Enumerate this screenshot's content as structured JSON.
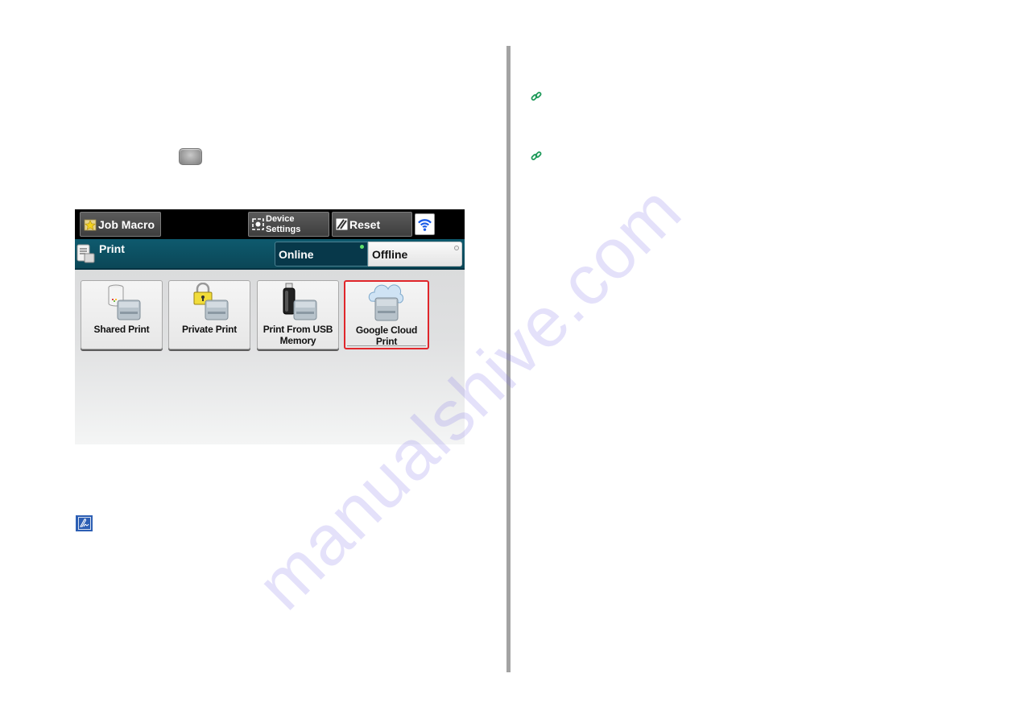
{
  "document": {
    "layout": "two-page spread",
    "left_page": {
      "hardware_key": {
        "icon": "rounded-gray-key-icon"
      },
      "panel_screenshot": {
        "top_bar": {
          "job_macro": {
            "label": "Job Macro",
            "icon": "star-folder-icon"
          },
          "device_settings": {
            "line1": "Device",
            "line2": "Settings",
            "icon": "gear-square-icon"
          },
          "reset": {
            "label": "Reset",
            "icon": "slash-reset-icon"
          },
          "wifi": {
            "icon": "wifi-icon",
            "color": "#1a5de8"
          }
        },
        "title_bar": {
          "title": "Print",
          "icon": "print-document-icon",
          "modes": [
            {
              "label": "Online",
              "selected": true,
              "indicator_color": "#5fe06a"
            },
            {
              "label": "Offline",
              "selected": false
            }
          ]
        },
        "functions": [
          {
            "label": "Shared Print",
            "icon": "shared-storage-printer-icon"
          },
          {
            "label": "Private Print",
            "icon": "padlock-printer-icon"
          },
          {
            "label_line1": "Print From USB",
            "label_line2": "Memory",
            "icon": "usb-printer-icon"
          },
          {
            "label": "Google Cloud Print",
            "icon": "cloud-printer-icon",
            "highlighted": true,
            "highlight_color": "#e0262b"
          }
        ]
      },
      "note": {
        "icon": "note-pencil-icon",
        "color": "#2d5fb4"
      }
    },
    "right_page": {
      "links": [
        {
          "icon": "link-icon",
          "color": "#1f9a5a"
        },
        {
          "icon": "link-icon",
          "color": "#1f9a5a"
        }
      ]
    },
    "watermark": "manualshive.com"
  }
}
